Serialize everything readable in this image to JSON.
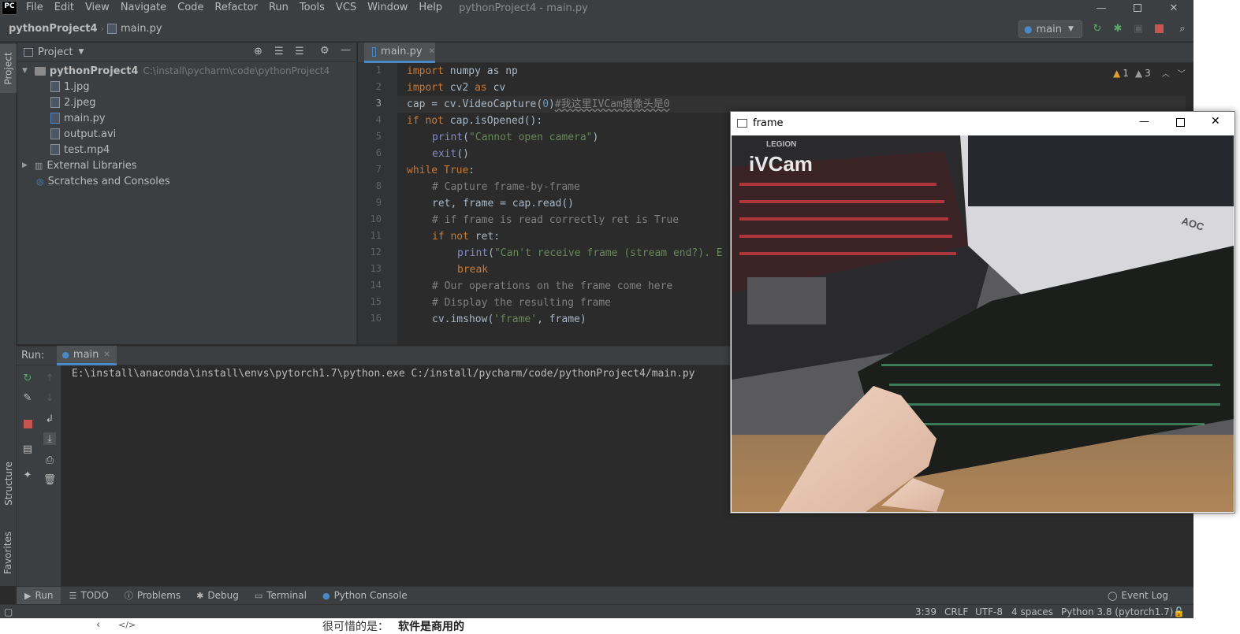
{
  "app": {
    "logo": "PC",
    "window_title": "pythonProject4 - main.py",
    "menu": [
      "File",
      "Edit",
      "View",
      "Navigate",
      "Code",
      "Refactor",
      "Run",
      "Tools",
      "VCS",
      "Window",
      "Help"
    ]
  },
  "navbar": {
    "project": "pythonProject4",
    "file": "main.py",
    "run_config": "main"
  },
  "sidebar": {
    "project_tab": "Project",
    "structure_tab": "Structure",
    "favorites_tab": "Favorites"
  },
  "project_panel": {
    "title": "Project",
    "root_name": "pythonProject4",
    "root_path": "C:\\install\\pycharm\\code\\pythonProject4",
    "files": [
      "1.jpg",
      "2.jpeg",
      "main.py",
      "output.avi",
      "test.mp4"
    ],
    "external": "External Libraries",
    "scratches": "Scratches and Consoles"
  },
  "editor": {
    "tab": "main.py",
    "warnings": "1",
    "weak_warnings": "3",
    "line_numbers": [
      "1",
      "2",
      "3",
      "4",
      "5",
      "6",
      "7",
      "8",
      "9",
      "10",
      "11",
      "12",
      "13",
      "14",
      "15",
      "16"
    ],
    "current_line": "3"
  },
  "code": {
    "l1_kw": "import",
    "l1_rest": " numpy as np",
    "l2_kw": "import",
    "l2_a": " cv2 ",
    "l2_as": "as",
    "l2_b": " cv",
    "l3_a": "cap = cv.VideoCapture(",
    "l3_num": "0",
    "l3_b": ")",
    "l3_cm": "#我这里IVCam摄像头是0",
    "l4_kw1": "if",
    "l4_kw2": " not",
    "l4_rest": " cap.isOpened():",
    "l5_fn": "print",
    "l5_a": "(",
    "l5_str": "\"Cannot open camera\"",
    "l5_b": ")",
    "l6_fn": "exit",
    "l6_rest": "()",
    "l7_kw": "while",
    "l7_kw2": " True",
    "l7_rest": ":",
    "l8_cm": "# Capture frame-by-frame",
    "l9": "ret, frame = cap.read()",
    "l10_cm": "# if frame is read correctly ret is True",
    "l11_kw1": "if",
    "l11_kw2": " not",
    "l11_rest": " ret:",
    "l12_fn": "print",
    "l12_a": "(",
    "l12_str": "\"Can't receive frame (stream end?). E",
    "l13_kw": "break",
    "l14_cm": "# Our operations on the frame come here",
    "l15_cm": "# Display the resulting frame",
    "l16_a": "cv.imshow(",
    "l16_str": "'frame'",
    "l16_b": ", frame)"
  },
  "run_panel": {
    "label": "Run:",
    "tab": "main",
    "command": "E:\\install\\anaconda\\install\\envs\\pytorch1.7\\python.exe C:/install/pycharm/code/pythonProject4/main.py"
  },
  "toolwindows": {
    "run": "Run",
    "todo": "TODO",
    "problems": "Problems",
    "debug": "Debug",
    "terminal": "Terminal",
    "python_console": "Python Console",
    "event_log": "Event Log"
  },
  "status": {
    "position": "3:39",
    "line_sep": "CRLF",
    "encoding": "UTF-8",
    "indent": "4 spaces",
    "interpreter": "Python 3.8 (pytorch1.7)"
  },
  "frame_window": {
    "title": "frame",
    "overlay": "iVCam",
    "laptop_brand": "LEGION",
    "monitor_brand": "AOC"
  },
  "below": {
    "text_a": "很可惜的是：",
    "text_b": "软件是商用的"
  },
  "colors": {
    "bg": "#2b2b2b",
    "panel": "#3c3f41",
    "keyword": "#cc7832",
    "string": "#6a8759",
    "comment": "#808080",
    "accent": "#4a88c7"
  }
}
